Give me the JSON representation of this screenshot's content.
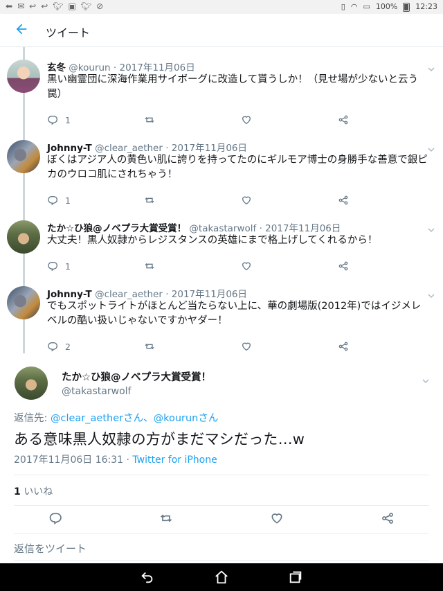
{
  "status_bar": {
    "battery": "100%",
    "time": "12:23"
  },
  "header": {
    "title": "ツイート"
  },
  "thread": [
    {
      "name": "玄冬",
      "handle": "@kourun",
      "date": "2017年11月06日",
      "text": "黒い幽霊団に深海作業用サイボーグに改造して貰うしか！（見せ場が少ないと云う罠）",
      "reply_count": "1"
    },
    {
      "name": "Johnny-T",
      "handle": "@clear_aether",
      "date": "2017年11月06日",
      "text": "ぼくはアジア人の黄色い肌に誇りを持ってたのにギルモア博士の身勝手な善意で銀ピカのウロコ肌にされちゃう！",
      "reply_count": "1"
    },
    {
      "name": "たか☆ひ狼@ノベプラ大賞受賞！",
      "handle": "@takastarwolf",
      "date": "2017年11月06日",
      "text": "大丈夫！黒人奴隷からレジスタンスの英雄にまで格上げしてくれるから！",
      "reply_count": "1"
    },
    {
      "name": "Johnny-T",
      "handle": "@clear_aether",
      "date": "2017年11月06日",
      "text": "でもスポットライトがほとんど当たらない上に、華の劇場版(2012年)ではイジメレベルの酷い扱いじゃないですかヤダー！",
      "reply_count": "2"
    }
  ],
  "focused": {
    "name": "たか☆ひ狼@ノベプラ大賞受賞！",
    "handle": "@takastarwolf",
    "reply_to_label": "返信先: ",
    "reply_to_users": "@clear_aetherさん、@kourunさん",
    "text": "ある意味黒人奴隷の方がまだマシだった…w",
    "datetime": "2017年11月06日 16:31 · ",
    "source": "Twitter for iPhone",
    "like_count": "1",
    "like_label": " いいね"
  },
  "reply_placeholder": "返信をツイート"
}
